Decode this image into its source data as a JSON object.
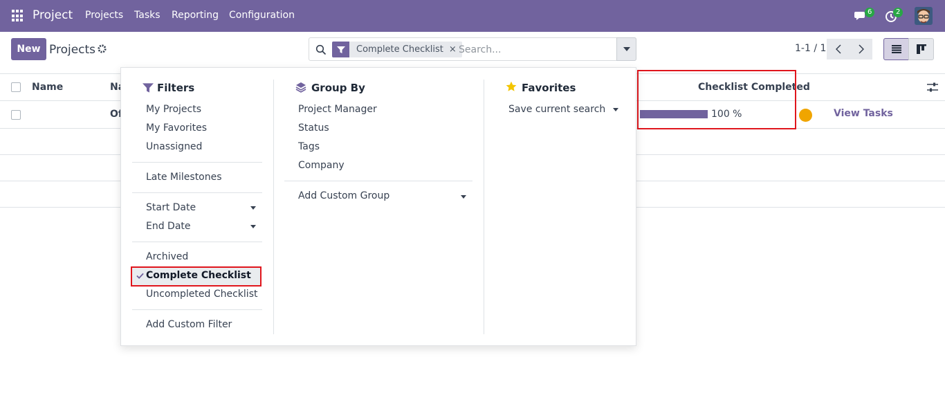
{
  "navbar": {
    "brand": "Project",
    "menu": [
      "Projects",
      "Tasks",
      "Reporting",
      "Configuration"
    ],
    "messages_badge": "6",
    "activity_badge": "2"
  },
  "control_panel": {
    "new_label": "New",
    "title": "Projects",
    "search": {
      "facet": "Complete Checklist",
      "facet_close": "×",
      "placeholder": "Search..."
    },
    "pager": "1-1 / 1"
  },
  "list": {
    "columns": [
      "Name",
      "Na",
      "Checklist Completed"
    ],
    "rows": [
      {
        "name_partial": "Of",
        "checklist_completed": 100,
        "checklist_text": "100 %",
        "status_color": "#f0a500",
        "action": "View Tasks"
      }
    ]
  },
  "dropdown": {
    "filters": {
      "title": "Filters",
      "groups": [
        [
          "My Projects",
          "My Favorites",
          "Unassigned"
        ],
        [
          "Late Milestones"
        ],
        [
          "Start Date",
          "End Date"
        ],
        [
          "Archived",
          "Complete Checklist",
          "Uncompleted Checklist"
        ],
        [
          "Add Custom Filter"
        ]
      ],
      "selected": "Complete Checklist"
    },
    "group_by": {
      "title": "Group By",
      "items": [
        "Project Manager",
        "Status",
        "Tags",
        "Company"
      ],
      "custom": "Add Custom Group"
    },
    "favorites": {
      "title": "Favorites",
      "items": [
        "Save current search"
      ]
    }
  },
  "colors": {
    "brand": "#71639e",
    "highlight": "#e0151c",
    "badge": "#28a745",
    "status": "#f0a500"
  }
}
